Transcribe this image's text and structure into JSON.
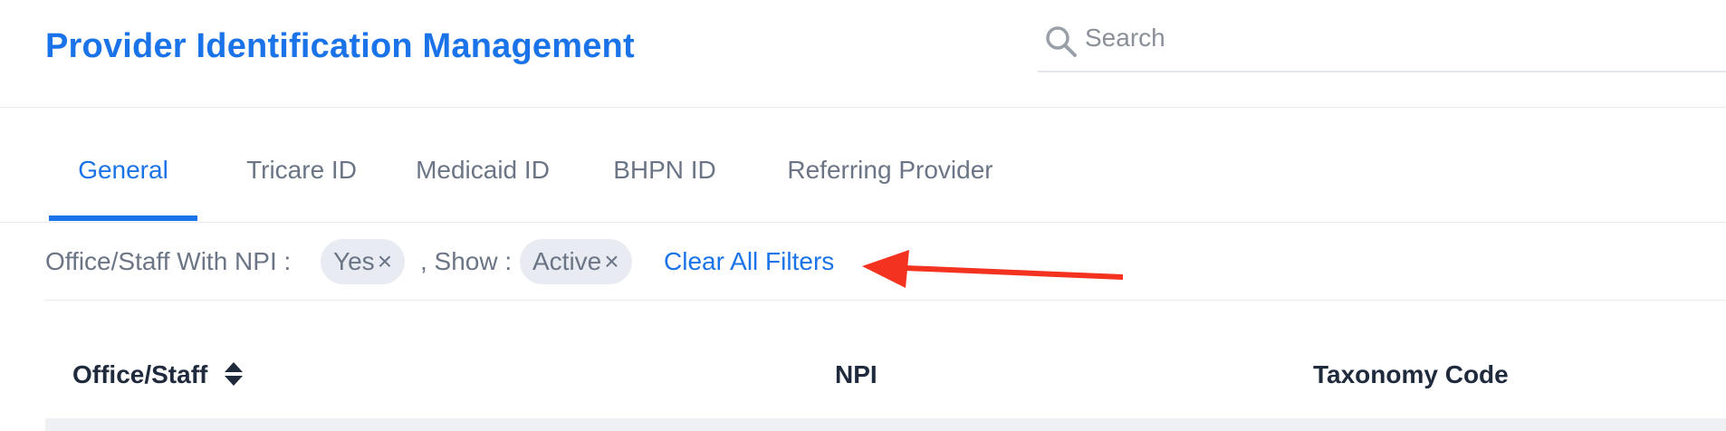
{
  "header": {
    "title": "Provider Identification Management",
    "search": {
      "placeholder": "Search",
      "value": "",
      "icon": "search-icon"
    }
  },
  "tabs": [
    {
      "label": "General",
      "active": true
    },
    {
      "label": "Tricare ID",
      "active": false
    },
    {
      "label": "Medicaid ID",
      "active": false
    },
    {
      "label": "BHPN ID",
      "active": false
    },
    {
      "label": "Referring Provider",
      "active": false
    }
  ],
  "filters": {
    "office_staff_label": "Office/Staff With NPI :",
    "office_staff_value": "Yes",
    "show_label": ", Show :",
    "show_value": "Active",
    "remove_symbol": "×",
    "clear_all": "Clear All Filters"
  },
  "table": {
    "columns": [
      {
        "label": "Office/Staff",
        "sortable": true,
        "sort_icon": "sort-icon"
      },
      {
        "label": "NPI",
        "sortable": false
      },
      {
        "label": "Taxonomy Code",
        "sortable": false
      }
    ]
  },
  "colors": {
    "accent": "#1a73e8",
    "annotation_arrow": "#f3321f",
    "chip_bg": "#e8ecf2",
    "muted_text": "#6b7585",
    "header_text": "#1f2a3c"
  }
}
